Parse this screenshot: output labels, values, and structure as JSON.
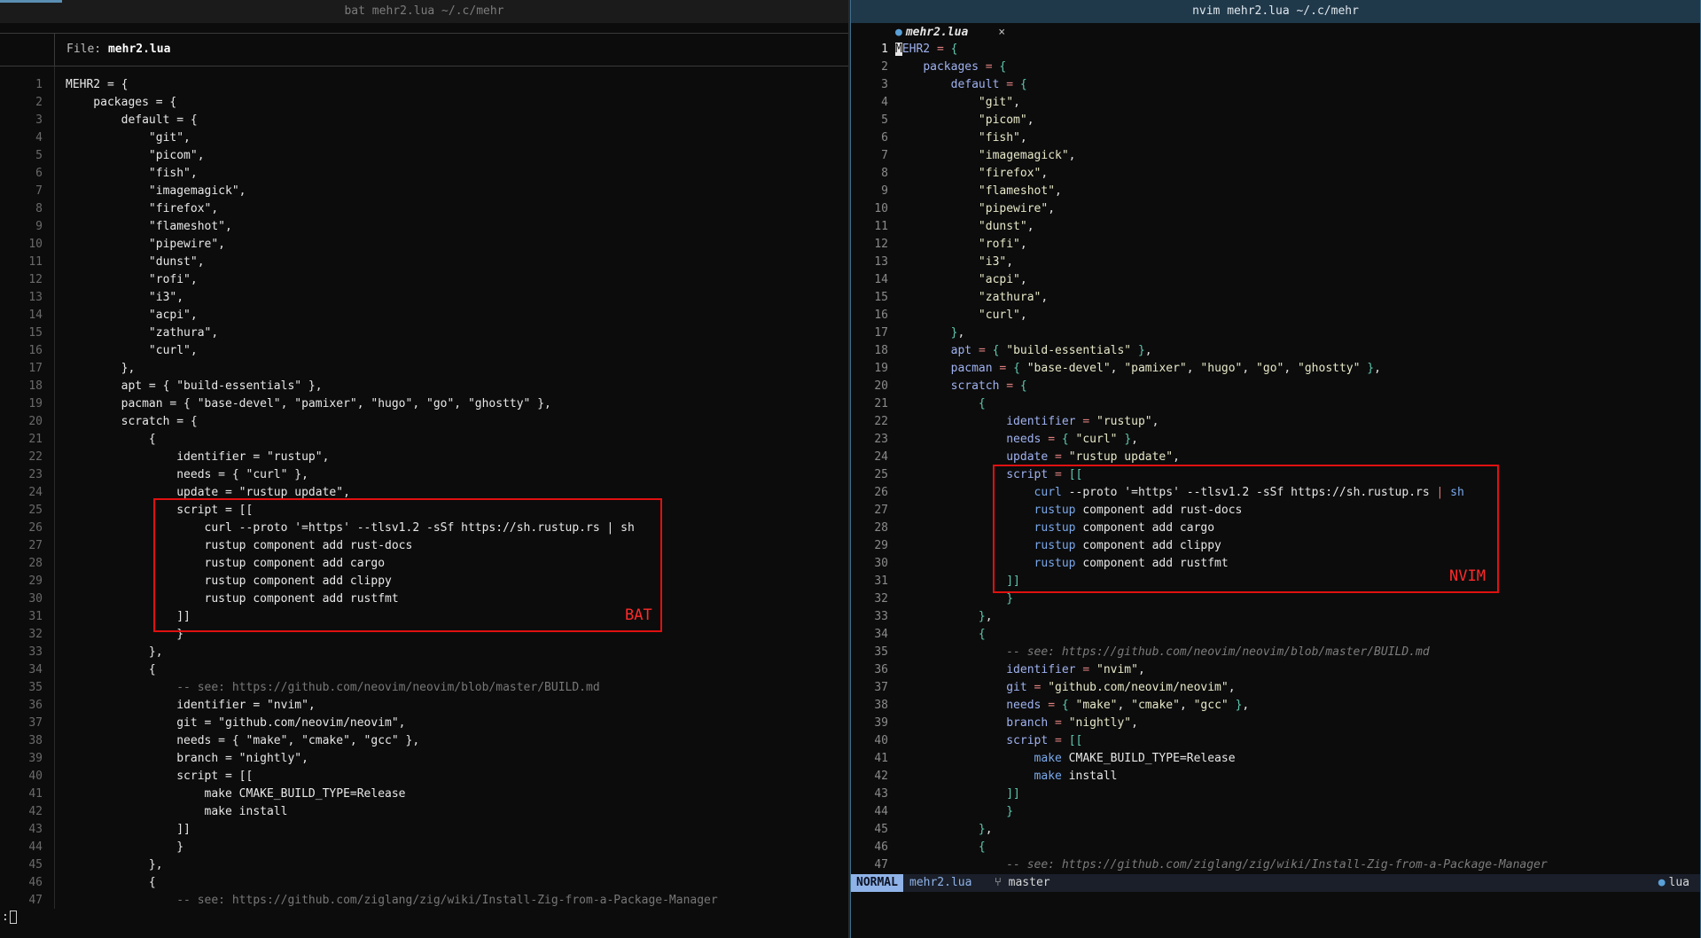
{
  "left": {
    "title": "bat mehr2.lua ~/.c/mehr",
    "header_prefix": "File: ",
    "header_file": "mehr2.lua",
    "lines": [
      {
        "n": "1",
        "indent": 0,
        "t": "MEHR2 = {"
      },
      {
        "n": "2",
        "indent": 1,
        "t": "packages = {"
      },
      {
        "n": "3",
        "indent": 2,
        "t": "default = {"
      },
      {
        "n": "4",
        "indent": 3,
        "t": "\"git\","
      },
      {
        "n": "5",
        "indent": 3,
        "t": "\"picom\","
      },
      {
        "n": "6",
        "indent": 3,
        "t": "\"fish\","
      },
      {
        "n": "7",
        "indent": 3,
        "t": "\"imagemagick\","
      },
      {
        "n": "8",
        "indent": 3,
        "t": "\"firefox\","
      },
      {
        "n": "9",
        "indent": 3,
        "t": "\"flameshot\","
      },
      {
        "n": "10",
        "indent": 3,
        "t": "\"pipewire\","
      },
      {
        "n": "11",
        "indent": 3,
        "t": "\"dunst\","
      },
      {
        "n": "12",
        "indent": 3,
        "t": "\"rofi\","
      },
      {
        "n": "13",
        "indent": 3,
        "t": "\"i3\","
      },
      {
        "n": "14",
        "indent": 3,
        "t": "\"acpi\","
      },
      {
        "n": "15",
        "indent": 3,
        "t": "\"zathura\","
      },
      {
        "n": "16",
        "indent": 3,
        "t": "\"curl\","
      },
      {
        "n": "17",
        "indent": 2,
        "t": "},"
      },
      {
        "n": "18",
        "indent": 2,
        "t": "apt = { \"build-essentials\" },"
      },
      {
        "n": "19",
        "indent": 2,
        "t": "pacman = { \"base-devel\", \"pamixer\", \"hugo\", \"go\", \"ghostty\" },"
      },
      {
        "n": "20",
        "indent": 2,
        "t": "scratch = {"
      },
      {
        "n": "21",
        "indent": 3,
        "t": "{"
      },
      {
        "n": "22",
        "indent": 4,
        "t": "identifier = \"rustup\","
      },
      {
        "n": "23",
        "indent": 4,
        "t": "needs = { \"curl\" },"
      },
      {
        "n": "24",
        "indent": 4,
        "t": "update = \"rustup update\","
      },
      {
        "n": "25",
        "indent": 4,
        "t": "script = [["
      },
      {
        "n": "26",
        "indent": 5,
        "t": "curl --proto '=https' --tlsv1.2 -sSf https://sh.rustup.rs | sh"
      },
      {
        "n": "27",
        "indent": 5,
        "t": "rustup component add rust-docs"
      },
      {
        "n": "28",
        "indent": 5,
        "t": "rustup component add cargo"
      },
      {
        "n": "29",
        "indent": 5,
        "t": "rustup component add clippy"
      },
      {
        "n": "30",
        "indent": 5,
        "t": "rustup component add rustfmt"
      },
      {
        "n": "31",
        "indent": 4,
        "t": "]]"
      },
      {
        "n": "32",
        "indent": 4,
        "t": "}"
      },
      {
        "n": "33",
        "indent": 3,
        "t": "},"
      },
      {
        "n": "34",
        "indent": 3,
        "t": "{"
      },
      {
        "n": "35",
        "indent": 4,
        "t": "-- see: https://github.com/neovim/neovim/blob/master/BUILD.md",
        "c": true
      },
      {
        "n": "36",
        "indent": 4,
        "t": "identifier = \"nvim\","
      },
      {
        "n": "37",
        "indent": 4,
        "t": "git = \"github.com/neovim/neovim\","
      },
      {
        "n": "38",
        "indent": 4,
        "t": "needs = { \"make\", \"cmake\", \"gcc\" },"
      },
      {
        "n": "39",
        "indent": 4,
        "t": "branch = \"nightly\","
      },
      {
        "n": "40",
        "indent": 4,
        "t": "script = [["
      },
      {
        "n": "41",
        "indent": 5,
        "t": "make CMAKE_BUILD_TYPE=Release"
      },
      {
        "n": "42",
        "indent": 5,
        "t": "make install"
      },
      {
        "n": "43",
        "indent": 4,
        "t": "]]"
      },
      {
        "n": "44",
        "indent": 4,
        "t": "}"
      },
      {
        "n": "45",
        "indent": 3,
        "t": "},"
      },
      {
        "n": "46",
        "indent": 3,
        "t": "{"
      },
      {
        "n": "47",
        "indent": 4,
        "t": "-- see: https://github.com/ziglang/zig/wiki/Install-Zig-from-a-Package-Manager",
        "c": true
      }
    ],
    "cmdline": ":",
    "annotation_label": "BAT"
  },
  "right": {
    "title": "nvim mehr2.lua  ~/.c/mehr",
    "tab_name": "mehr2.lua",
    "tab_close": "×",
    "lines": [
      {
        "n": "1",
        "indent": 0,
        "t": "MEHR2 = {",
        "cur": true
      },
      {
        "n": "2",
        "indent": 1,
        "t": "packages = {"
      },
      {
        "n": "3",
        "indent": 2,
        "t": "default = {"
      },
      {
        "n": "4",
        "indent": 3,
        "t": "\"git\","
      },
      {
        "n": "5",
        "indent": 3,
        "t": "\"picom\","
      },
      {
        "n": "6",
        "indent": 3,
        "t": "\"fish\","
      },
      {
        "n": "7",
        "indent": 3,
        "t": "\"imagemagick\","
      },
      {
        "n": "8",
        "indent": 3,
        "t": "\"firefox\","
      },
      {
        "n": "9",
        "indent": 3,
        "t": "\"flameshot\","
      },
      {
        "n": "10",
        "indent": 3,
        "t": "\"pipewire\","
      },
      {
        "n": "11",
        "indent": 3,
        "t": "\"dunst\","
      },
      {
        "n": "12",
        "indent": 3,
        "t": "\"rofi\","
      },
      {
        "n": "13",
        "indent": 3,
        "t": "\"i3\","
      },
      {
        "n": "14",
        "indent": 3,
        "t": "\"acpi\","
      },
      {
        "n": "15",
        "indent": 3,
        "t": "\"zathura\","
      },
      {
        "n": "16",
        "indent": 3,
        "t": "\"curl\","
      },
      {
        "n": "17",
        "indent": 2,
        "t": "},"
      },
      {
        "n": "18",
        "indent": 2,
        "t": "apt = { \"build-essentials\" },"
      },
      {
        "n": "19",
        "indent": 2,
        "t": "pacman = { \"base-devel\", \"pamixer\", \"hugo\", \"go\", \"ghostty\" },"
      },
      {
        "n": "20",
        "indent": 2,
        "t": "scratch = {"
      },
      {
        "n": "21",
        "indent": 3,
        "t": "{"
      },
      {
        "n": "22",
        "indent": 4,
        "t": "identifier = \"rustup\","
      },
      {
        "n": "23",
        "indent": 4,
        "t": "needs = { \"curl\" },"
      },
      {
        "n": "24",
        "indent": 4,
        "t": "update = \"rustup update\","
      },
      {
        "n": "25",
        "indent": 4,
        "t": "script = [["
      },
      {
        "n": "26",
        "indent": 5,
        "t": "curl --proto '=https' --tlsv1.2 -sSf https://sh.rustup.rs | sh",
        "sh": true
      },
      {
        "n": "27",
        "indent": 5,
        "t": "rustup component add rust-docs",
        "sh": true
      },
      {
        "n": "28",
        "indent": 5,
        "t": "rustup component add cargo",
        "sh": true
      },
      {
        "n": "29",
        "indent": 5,
        "t": "rustup component add clippy",
        "sh": true
      },
      {
        "n": "30",
        "indent": 5,
        "t": "rustup component add rustfmt",
        "sh": true
      },
      {
        "n": "31",
        "indent": 4,
        "t": "]]"
      },
      {
        "n": "32",
        "indent": 4,
        "t": "}"
      },
      {
        "n": "33",
        "indent": 3,
        "t": "},"
      },
      {
        "n": "34",
        "indent": 3,
        "t": "{"
      },
      {
        "n": "35",
        "indent": 4,
        "t": "-- see: https://github.com/neovim/neovim/blob/master/BUILD.md",
        "c": true
      },
      {
        "n": "36",
        "indent": 4,
        "t": "identifier = \"nvim\","
      },
      {
        "n": "37",
        "indent": 4,
        "t": "git = \"github.com/neovim/neovim\","
      },
      {
        "n": "38",
        "indent": 4,
        "t": "needs = { \"make\", \"cmake\", \"gcc\" },"
      },
      {
        "n": "39",
        "indent": 4,
        "t": "branch = \"nightly\","
      },
      {
        "n": "40",
        "indent": 4,
        "t": "script = [["
      },
      {
        "n": "41",
        "indent": 5,
        "t": "make CMAKE_BUILD_TYPE=Release",
        "sh": true
      },
      {
        "n": "42",
        "indent": 5,
        "t": "make install",
        "sh": true
      },
      {
        "n": "43",
        "indent": 4,
        "t": "]]"
      },
      {
        "n": "44",
        "indent": 4,
        "t": "}"
      },
      {
        "n": "45",
        "indent": 3,
        "t": "},"
      },
      {
        "n": "46",
        "indent": 3,
        "t": "{"
      },
      {
        "n": "47",
        "indent": 4,
        "t": "-- see: https://github.com/ziglang/zig/wiki/Install-Zig-from-a-Package-Manager",
        "c": true
      }
    ],
    "status": {
      "mode": "NORMAL",
      "file": "mehr2.lua",
      "branch_icon": "branch-icon",
      "branch": "master",
      "filetype": "lua"
    },
    "annotation_label": "NVIM"
  },
  "colors": {
    "annotation": "#e01010",
    "nvim_border": "#3f6f8e",
    "mode_bg": "#8fb3e8"
  }
}
